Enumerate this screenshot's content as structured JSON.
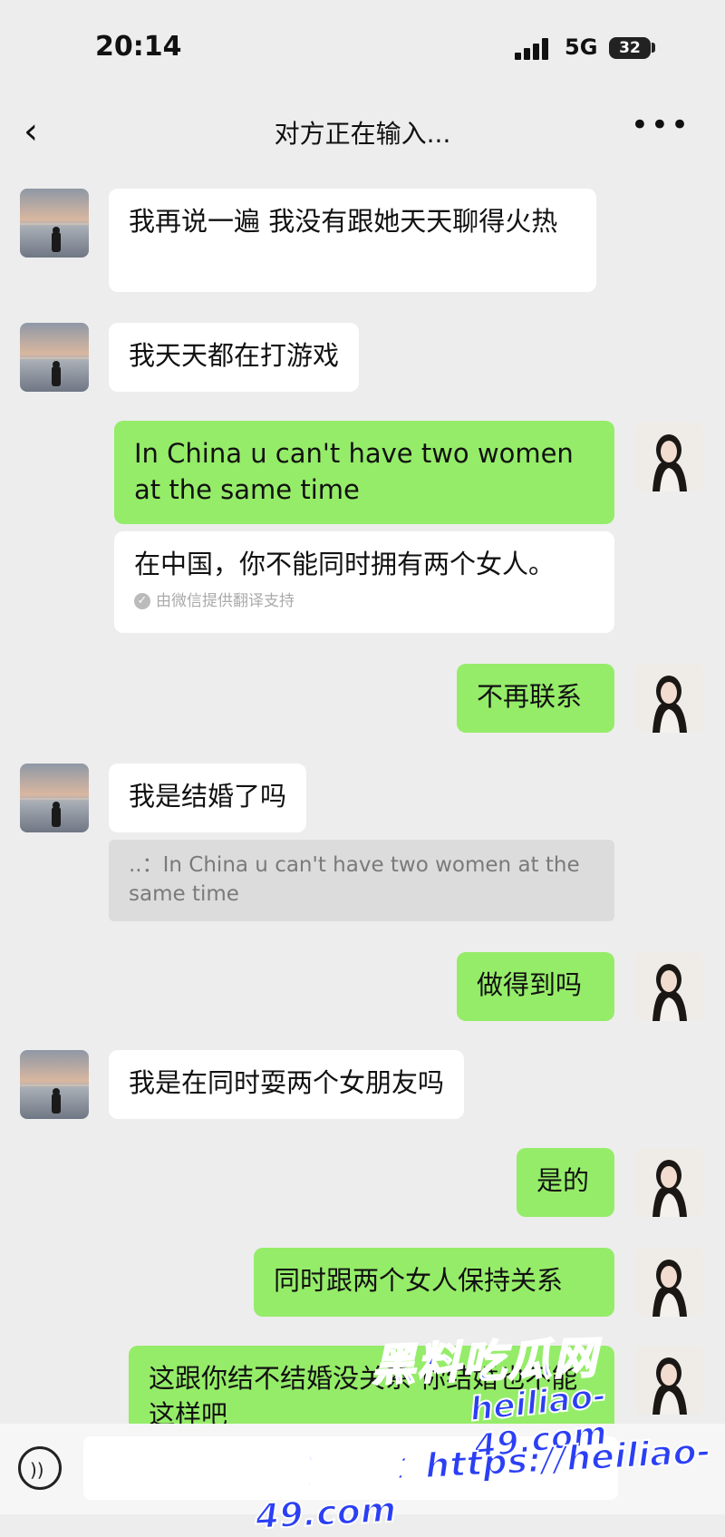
{
  "status_bar": {
    "time": "20:14",
    "network": "5G",
    "battery": "32"
  },
  "header": {
    "title": "对方正在输入..."
  },
  "messages": [
    {
      "side": "in",
      "text": "我再说一遍 我没有跟她天天聊得火热"
    },
    {
      "side": "in",
      "text": "我天天都在打游戏"
    },
    {
      "side": "out",
      "text": "In China u can't have two women at the same time"
    },
    {
      "translation": "在中国，你不能同时拥有两个女人。",
      "credit": "由微信提供翻译支持"
    },
    {
      "side": "out",
      "text": "不再联系"
    },
    {
      "side": "in",
      "text": "我是结婚了吗"
    },
    {
      "quote": "..：In China u can't have two women at the same time"
    },
    {
      "side": "out",
      "text": "做得到吗"
    },
    {
      "side": "in",
      "text": "我是在同时耍两个女朋友吗"
    },
    {
      "side": "out",
      "text": "是的"
    },
    {
      "side": "out",
      "text": "同时跟两个女人保持关系"
    },
    {
      "side": "out",
      "text": "这跟你结不结婚没关系 你结婚也不能这样吧"
    }
  ],
  "watermark": {
    "logo": "黑料吃瓜网",
    "url": "heiliao-49.com",
    "full": "看完整版：https://heiliao-49.com"
  },
  "colors": {
    "incoming": "#ffffff",
    "outgoing": "#95ec69",
    "background": "#ededed"
  }
}
